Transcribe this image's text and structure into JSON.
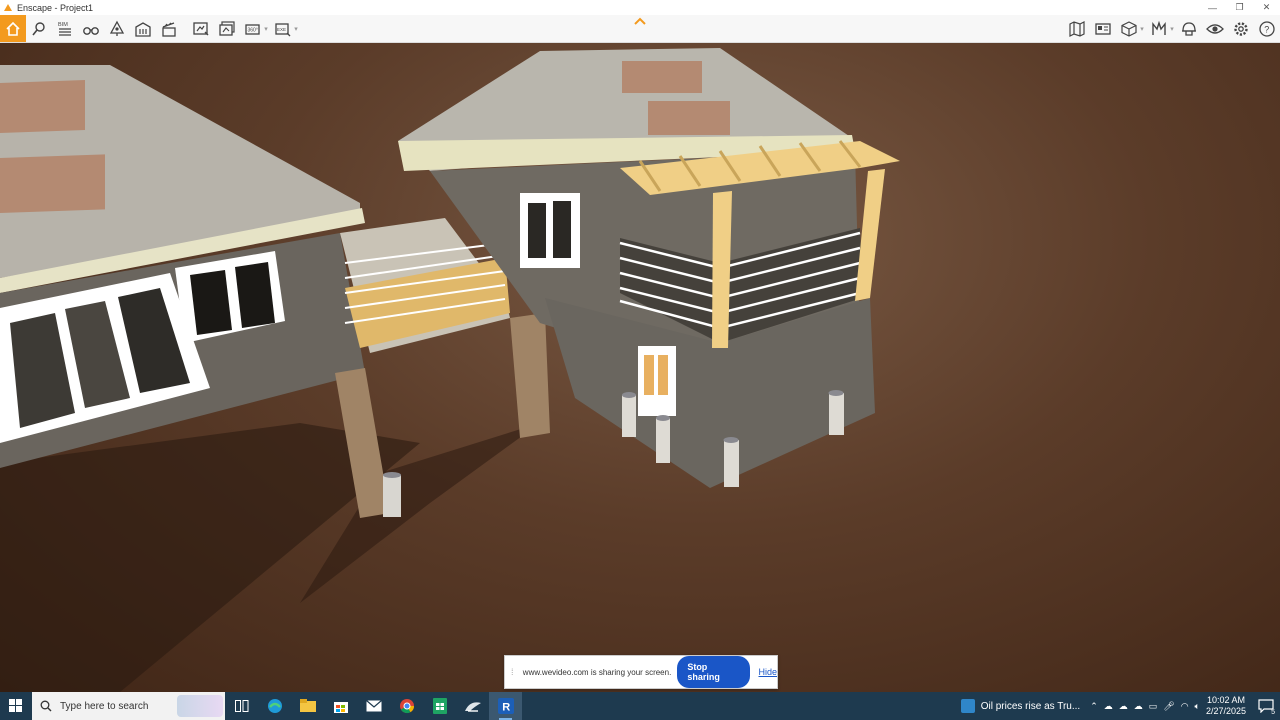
{
  "window": {
    "title": "Enscape - Project1",
    "controls": [
      "—",
      "❐",
      "✕"
    ]
  },
  "toolbar": {
    "left_tools": [
      {
        "name": "home-button",
        "icon": "home-icon"
      },
      {
        "name": "visual-settings-button",
        "icon": "location-icon"
      },
      {
        "name": "bim-button",
        "icon": "bim-icon",
        "label": "BIM"
      },
      {
        "name": "views-button",
        "icon": "binoculars-icon"
      },
      {
        "name": "assets-button",
        "icon": "tree-icon"
      },
      {
        "name": "building-button",
        "icon": "building-icon"
      },
      {
        "name": "clapper-button",
        "icon": "clapper-icon"
      },
      {
        "name": "screenshot-button",
        "icon": "screenshot-icon"
      },
      {
        "name": "batch-render-button",
        "icon": "batch-icon"
      },
      {
        "name": "panorama-button",
        "icon": "panorama-icon",
        "label": "360°"
      },
      {
        "name": "export-button",
        "icon": "export-icon",
        "label": "EXE"
      }
    ],
    "right_tools": [
      {
        "name": "map-button",
        "icon": "map-icon"
      },
      {
        "name": "camera-button",
        "icon": "camera-icon"
      },
      {
        "name": "cube-button",
        "icon": "cube-icon"
      },
      {
        "name": "materials-button",
        "icon": "materials-icon"
      },
      {
        "name": "assistant-button",
        "icon": "helmet-icon"
      },
      {
        "name": "visibility-button",
        "icon": "eye-icon"
      },
      {
        "name": "settings-button",
        "icon": "gear-icon"
      },
      {
        "name": "help-button",
        "icon": "help-icon"
      }
    ],
    "accent": "#f39a1e"
  },
  "share_banner": {
    "message": "www.wevideo.com is sharing your screen.",
    "stop_label": "Stop sharing",
    "hide_label": "Hide"
  },
  "taskbar": {
    "search_placeholder": "Type here to search",
    "apps": [
      "task-view-icon",
      "edge-icon",
      "file-explorer-icon",
      "store-icon",
      "mail-icon",
      "chrome-icon",
      "sheets-icon",
      "enscape-icon",
      "revit-icon"
    ],
    "active_app": "revit-icon",
    "news": "Oil prices rise as Tru...",
    "time": "10:02 AM",
    "date": "2/27/2025",
    "notification_count": "5"
  },
  "colors": {
    "ground": "#5b3c29",
    "roof": "#b9b6ad",
    "siding": "#6f6a62",
    "pergola": "#f0cf86",
    "taskbar": "#1e3a4f"
  }
}
